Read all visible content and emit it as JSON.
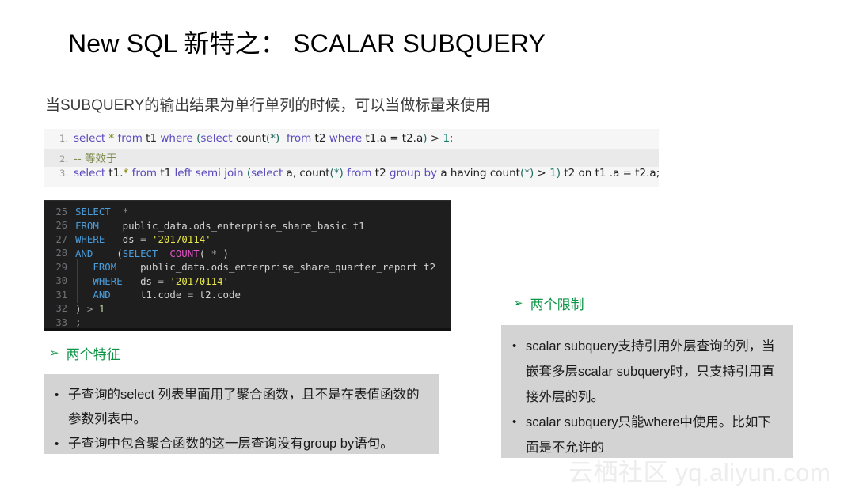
{
  "slide": {
    "title": "New SQL 新特之： SCALAR SUBQUERY",
    "subtitle": "当SUBQUERY的输出结果为单行单列的时候，可以当做标量来使用",
    "watermark": "云栖社区 yq.aliyun.com"
  },
  "code_light": {
    "lines": [
      {
        "num": "1.",
        "alt": false
      },
      {
        "num": "2.",
        "alt": true
      },
      {
        "num": "3.",
        "alt": false
      }
    ],
    "line1_plain": "select * from t1 where (select count(*)  from t2 where t1.a = t2.a) > 1;",
    "line2_plain": "-- 等效于",
    "line3_plain": "select t1.* from t1 left semi join (select a, count(*) from t2 group by a having count(*) > 1) t2 on t1 .a = t2.a;",
    "tokens": {
      "l1": [
        {
          "t": "select",
          "c": "k"
        },
        {
          "t": " ",
          "c": "pl"
        },
        {
          "t": "*",
          "c": "st"
        },
        {
          "t": " ",
          "c": "pl"
        },
        {
          "t": "from",
          "c": "k"
        },
        {
          "t": " t1 ",
          "c": "pl"
        },
        {
          "t": "where",
          "c": "k"
        },
        {
          "t": " ",
          "c": "pl"
        },
        {
          "t": "(",
          "c": "fn"
        },
        {
          "t": "select",
          "c": "k"
        },
        {
          "t": " count",
          "c": "pl"
        },
        {
          "t": "(*)",
          "c": "fn"
        },
        {
          "t": "  ",
          "c": "pl"
        },
        {
          "t": "from",
          "c": "k"
        },
        {
          "t": " t2 ",
          "c": "pl"
        },
        {
          "t": "where",
          "c": "k"
        },
        {
          "t": " t1.a = t2.a",
          "c": "pl"
        },
        {
          "t": ")",
          "c": "fn"
        },
        {
          "t": " > ",
          "c": "pl"
        },
        {
          "t": "1;",
          "c": "nm"
        }
      ],
      "l2": [
        {
          "t": "-- 等效于",
          "c": "cm"
        }
      ],
      "l3": [
        {
          "t": "select",
          "c": "k"
        },
        {
          "t": " t1.",
          "c": "pl"
        },
        {
          "t": "*",
          "c": "st"
        },
        {
          "t": " ",
          "c": "pl"
        },
        {
          "t": "from",
          "c": "k"
        },
        {
          "t": " t1 ",
          "c": "pl"
        },
        {
          "t": "left semi join",
          "c": "k"
        },
        {
          "t": " ",
          "c": "pl"
        },
        {
          "t": "(",
          "c": "fn"
        },
        {
          "t": "select",
          "c": "k"
        },
        {
          "t": " a, count",
          "c": "pl"
        },
        {
          "t": "(*)",
          "c": "fn"
        },
        {
          "t": " ",
          "c": "pl"
        },
        {
          "t": "from",
          "c": "k"
        },
        {
          "t": " t2 ",
          "c": "pl"
        },
        {
          "t": "group by",
          "c": "k"
        },
        {
          "t": " a having count",
          "c": "pl"
        },
        {
          "t": "(*)",
          "c": "fn"
        },
        {
          "t": " > ",
          "c": "pl"
        },
        {
          "t": "1",
          "c": "nm"
        },
        {
          "t": ")",
          "c": "fn"
        },
        {
          "t": " t2 on t1 .a = t2.a;",
          "c": "pl"
        }
      ]
    }
  },
  "code_dark": {
    "lines": [
      {
        "num": "25",
        "indent": false,
        "tokens": [
          {
            "t": "SELECT",
            "c": "dk"
          },
          {
            "t": "  ",
            "c": "dp"
          },
          {
            "t": "*",
            "c": "do"
          }
        ]
      },
      {
        "num": "26",
        "indent": false,
        "tokens": [
          {
            "t": "FROM",
            "c": "dk"
          },
          {
            "t": "    public_data.ods_enterprise_share_basic t1",
            "c": "dp"
          }
        ]
      },
      {
        "num": "27",
        "indent": false,
        "tokens": [
          {
            "t": "WHERE",
            "c": "dk"
          },
          {
            "t": "   ds ",
            "c": "dp"
          },
          {
            "t": "=",
            "c": "do"
          },
          {
            "t": " ",
            "c": "dp"
          },
          {
            "t": "'20170114'",
            "c": "ds"
          }
        ]
      },
      {
        "num": "28",
        "indent": false,
        "tokens": [
          {
            "t": "AND",
            "c": "dk"
          },
          {
            "t": "    (",
            "c": "dp"
          },
          {
            "t": "SELECT",
            "c": "dk"
          },
          {
            "t": "  ",
            "c": "dp"
          },
          {
            "t": "COUNT",
            "c": "dm"
          },
          {
            "t": "( ",
            "c": "dp"
          },
          {
            "t": "*",
            "c": "do"
          },
          {
            "t": " )",
            "c": "dp"
          }
        ]
      },
      {
        "num": "29",
        "indent": true,
        "tokens": [
          {
            "t": "   ",
            "c": "dp"
          },
          {
            "t": "FROM",
            "c": "dk"
          },
          {
            "t": "    public_data.ods_enterprise_share_quarter_report t2",
            "c": "dp"
          }
        ]
      },
      {
        "num": "30",
        "indent": true,
        "tokens": [
          {
            "t": "   ",
            "c": "dp"
          },
          {
            "t": "WHERE",
            "c": "dk"
          },
          {
            "t": "   ds ",
            "c": "dp"
          },
          {
            "t": "=",
            "c": "do"
          },
          {
            "t": " ",
            "c": "dp"
          },
          {
            "t": "'20170114'",
            "c": "ds"
          }
        ]
      },
      {
        "num": "31",
        "indent": true,
        "tokens": [
          {
            "t": "   ",
            "c": "dp"
          },
          {
            "t": "AND",
            "c": "dk"
          },
          {
            "t": "     t1.code ",
            "c": "dp"
          },
          {
            "t": "=",
            "c": "do"
          },
          {
            "t": " t2.code",
            "c": "dp"
          }
        ]
      },
      {
        "num": "32",
        "indent": false,
        "tokens": [
          {
            "t": ") ",
            "c": "dp"
          },
          {
            "t": ">",
            "c": "do"
          },
          {
            "t": " ",
            "c": "dp"
          },
          {
            "t": "1",
            "c": "dn"
          }
        ]
      },
      {
        "num": "33",
        "indent": false,
        "tokens": [
          {
            "t": ";",
            "c": "dp"
          }
        ]
      }
    ]
  },
  "features": {
    "arrow": "➢",
    "heading": "两个特征",
    "bullet_marker": "•",
    "bullets": [
      "子查询的select 列表里面用了聚合函数，且不是在表值函数的参数列表中。",
      "子查询中包含聚合函数的这一层查询没有group by语句。"
    ]
  },
  "limits": {
    "arrow": "➢",
    "heading": "两个限制",
    "bullet_marker": "•",
    "bullets": [
      "scalar subquery支持引用外层查询的列，当嵌套多层scalar subquery时，只支持引用直接外层的列。",
      "scalar subquery只能where中使用。比如下面是不允许的"
    ]
  },
  "colors": {
    "heading_green": "#0b9444",
    "gray_box": "#d3d3d3",
    "light_code_bg": "#f6f6f6",
    "light_code_alt": "#eaeaea",
    "dark_code_bg": "#1e1e1e",
    "watermark": "#ededed"
  }
}
